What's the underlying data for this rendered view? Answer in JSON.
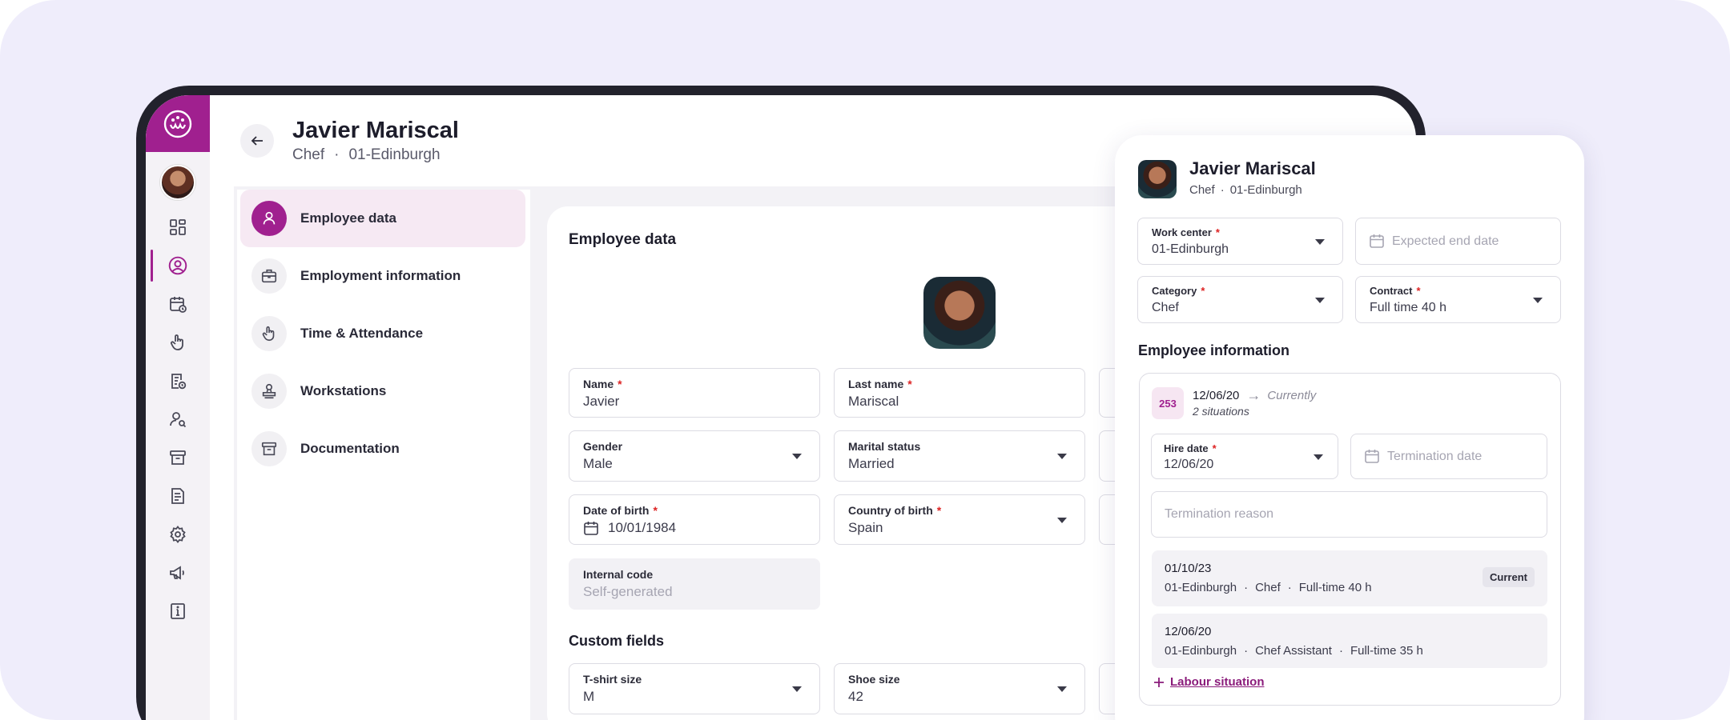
{
  "employee": {
    "name": "Javier Mariscal",
    "category": "Chef",
    "separator": "·",
    "work_center": "01-Edinburgh"
  },
  "sidenav": {
    "items": [
      {
        "label": "Employee data",
        "icon": "user-icon",
        "active": true
      },
      {
        "label": "Employment information",
        "icon": "briefcase-icon",
        "active": false
      },
      {
        "label": "Time & Attendance",
        "icon": "hand-pointer-icon",
        "active": false
      },
      {
        "label": "Workstations",
        "icon": "stamp-icon",
        "active": false
      },
      {
        "label": "Documentation",
        "icon": "archive-icon",
        "active": false
      }
    ]
  },
  "rail": {
    "icons": [
      "dashboard-icon",
      "user-circle-icon",
      "calendar-clock-icon",
      "hand-pointer-icon",
      "document-clock-icon",
      "user-search-icon",
      "archive-icon",
      "report-icon",
      "gear-icon",
      "megaphone-icon",
      "info-icon"
    ],
    "active_index": 1
  },
  "form": {
    "title": "Employee data",
    "name": {
      "label": "Name",
      "value": "Javier"
    },
    "last_name": {
      "label": "Last name",
      "value": "Mariscal"
    },
    "gender": {
      "label": "Gender",
      "value": "Male"
    },
    "marital_status": {
      "label": "Marital status",
      "value": "Married"
    },
    "date_of_birth": {
      "label": "Date of birth",
      "value": "10/01/1984"
    },
    "country_of_birth": {
      "label": "Country of birth",
      "value": "Spain"
    },
    "internal_code": {
      "label": "Internal code",
      "placeholder": "Self-generated"
    },
    "required_mark": "*"
  },
  "custom_fields": {
    "title": "Custom fields",
    "tshirt": {
      "label": "T-shirt size",
      "value": "M"
    },
    "shoe": {
      "label": "Shoe size",
      "value": "42"
    }
  },
  "panel": {
    "work_center": {
      "label": "Work center",
      "value": "01-Edinburgh"
    },
    "expected_end_date": {
      "placeholder": "Expected end date"
    },
    "category": {
      "label": "Category",
      "value": "Chef"
    },
    "contract": {
      "label": "Contract",
      "value": "Full time 40 h"
    },
    "info_title": "Employee information",
    "situation": {
      "badge": "253",
      "start": "12/06/20",
      "arrow": "→",
      "end": "Currently",
      "count": "2 situations"
    },
    "hire_date": {
      "label": "Hire date",
      "value": "12/06/20"
    },
    "termination_date": {
      "placeholder": "Termination date"
    },
    "termination_reason": {
      "placeholder": "Termination reason"
    },
    "history": [
      {
        "date": "01/10/23",
        "center": "01-Edinburgh",
        "role": "Chef",
        "time": "Full-time 40 h",
        "tag": "Current"
      },
      {
        "date": "12/06/20",
        "center": "01-Edinburgh",
        "role": "Chef Assistant",
        "time": "Full-time 35 h",
        "tag": ""
      }
    ],
    "add_label": "Labour situation"
  },
  "colors": {
    "brand": "#a0208f",
    "background": "#efedfb",
    "frame": "#22222c"
  }
}
